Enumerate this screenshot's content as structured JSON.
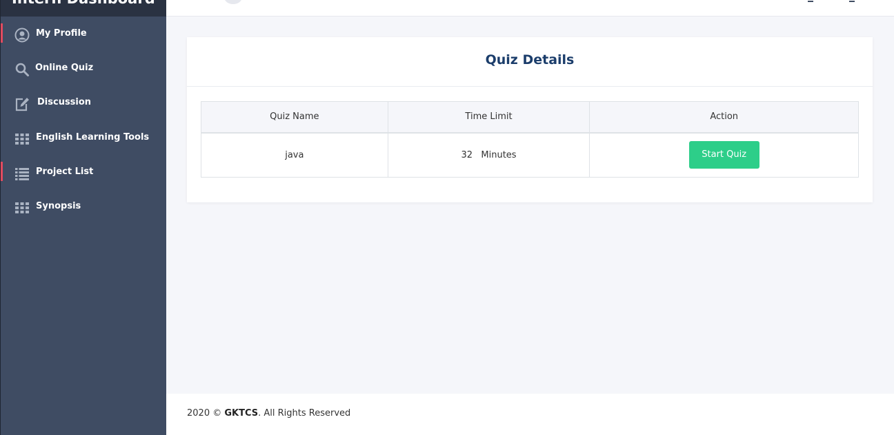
{
  "sidebar": {
    "brand": "Intern Dashboard",
    "items": [
      {
        "label": "My Profile",
        "icon": "user-circle-icon",
        "marked": true
      },
      {
        "label": "Online Quiz",
        "icon": "search-icon",
        "marked": false
      },
      {
        "label": "Discussion",
        "icon": "edit-icon",
        "marked": false
      },
      {
        "label": "English Learning Tools",
        "icon": "grid-icon",
        "marked": false
      },
      {
        "label": "Project List",
        "icon": "list-icon",
        "marked": true
      },
      {
        "label": "Synopsis",
        "icon": "grid-icon",
        "marked": false
      }
    ]
  },
  "card": {
    "title": "Quiz Details"
  },
  "table": {
    "headers": [
      "Quiz Name",
      "Time Limit",
      "Action"
    ],
    "rows": [
      {
        "quiz_name": "java",
        "time_value": "32",
        "time_unit": "Minutes",
        "action_label": "Start Quiz"
      }
    ]
  },
  "footer": {
    "prefix": "2020 ©",
    "company": "GKTCS",
    "suffix": ". All Rights Reserved"
  },
  "colors": {
    "sidebar_bg": "#3f4c63",
    "accent_marker": "#e24b5f",
    "title_color": "#1b3d6b",
    "button_green": "#2dce89"
  }
}
